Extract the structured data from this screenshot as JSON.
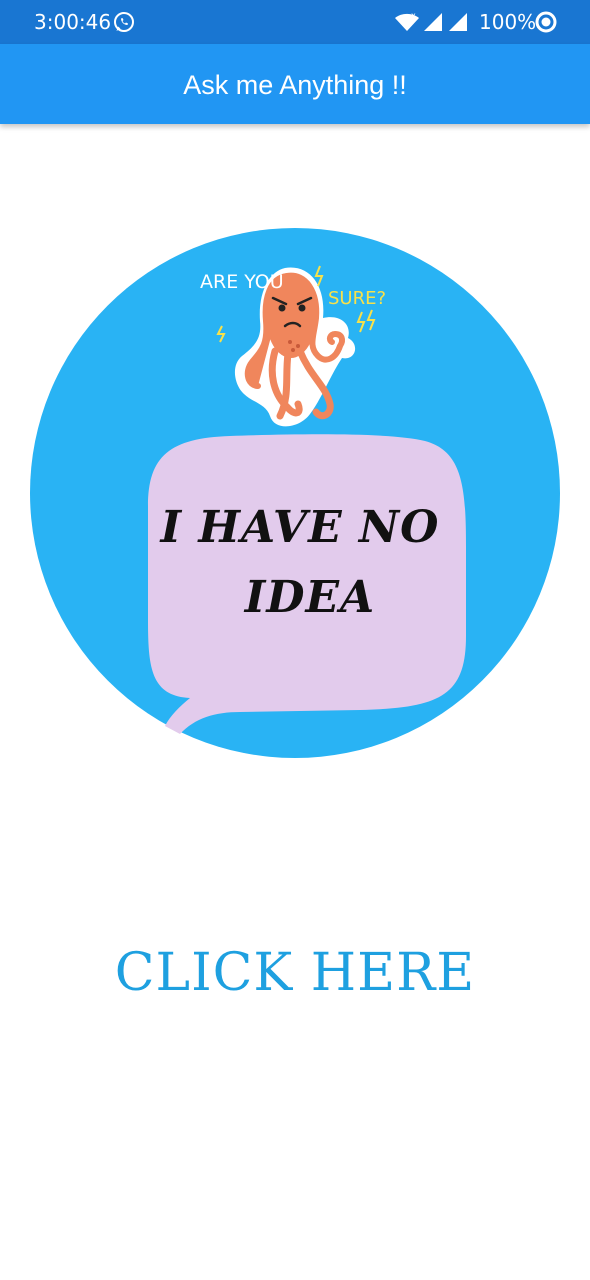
{
  "status_bar": {
    "time": "3:00:46",
    "battery": "100%",
    "icons": [
      "whatsapp-icon",
      "wifi-icon",
      "cell-signal-icon",
      "cell-signal-icon",
      "circle-status-icon"
    ]
  },
  "app_bar": {
    "title": "Ask me Anything !!"
  },
  "answer_image": {
    "sticker_text_left": "ARE YOU",
    "sticker_text_right": "SURE?",
    "bubble_line1": "I HAVE NO",
    "bubble_line2": "IDEA",
    "colors": {
      "circle": "#29b3f4",
      "bubble": "#e2cbec",
      "octopus": "#f0865c"
    }
  },
  "main": {
    "button_label": "CLICK HERE"
  },
  "colors": {
    "status_bar": "#1976d2",
    "app_bar": "#2196f3",
    "button_text": "#1ea0e0"
  }
}
